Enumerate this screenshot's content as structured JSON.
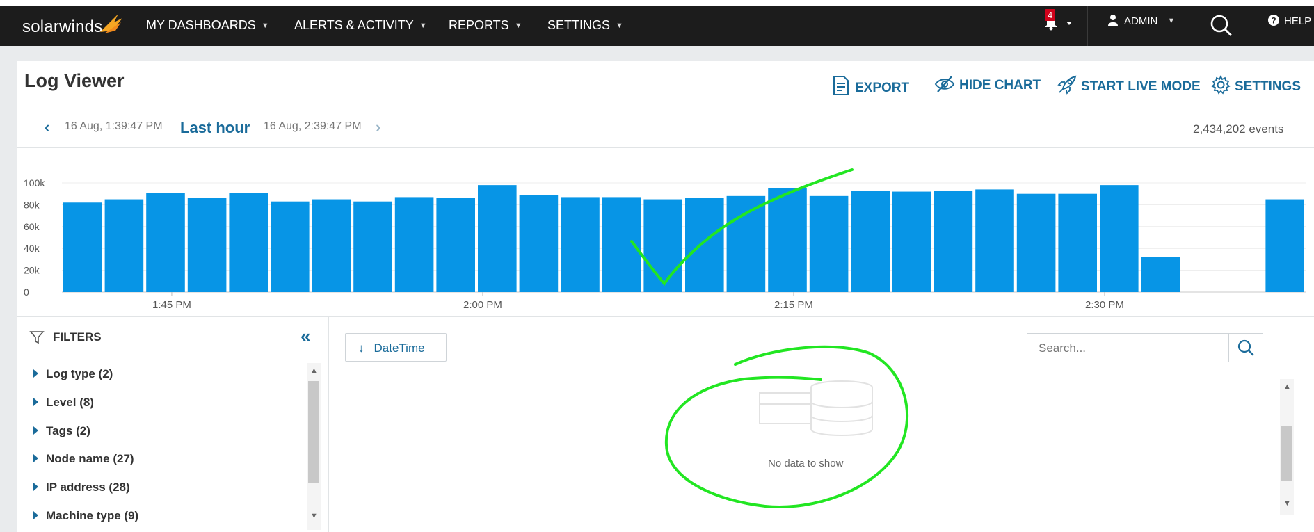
{
  "topbar": {
    "logo_text": "solarwinds",
    "nav": [
      {
        "label": "MY DASHBOARDS"
      },
      {
        "label": "ALERTS & ACTIVITY"
      },
      {
        "label": "REPORTS"
      },
      {
        "label": "SETTINGS"
      }
    ],
    "alert_count": "4",
    "user_label": "ADMIN",
    "help_label": "HELP"
  },
  "header": {
    "title": "Log Viewer",
    "actions": {
      "export": "EXPORT",
      "hide_chart": "HIDE CHART",
      "live_mode": "START LIVE MODE",
      "settings": "SETTINGS"
    }
  },
  "timerange": {
    "start": "16 Aug, 1:39:47 PM",
    "label": "Last hour",
    "end": "16 Aug, 2:39:47 PM",
    "events": "2,434,202 events"
  },
  "chart_data": {
    "type": "bar",
    "y_ticks": [
      "100k",
      "80k",
      "60k",
      "40k",
      "20k",
      "0"
    ],
    "ylim": [
      0,
      100000
    ],
    "x_ticks": [
      "1:45 PM",
      "2:00 PM",
      "2:15 PM",
      "2:30 PM"
    ],
    "values": [
      82000,
      85000,
      91000,
      86000,
      91000,
      83000,
      85000,
      83000,
      87000,
      86000,
      98000,
      89000,
      87000,
      87000,
      85000,
      86000,
      88000,
      95000,
      88000,
      93000,
      92000,
      93000,
      94000,
      90000,
      90000,
      98000,
      32000,
      0,
      0,
      85000
    ],
    "color": "#0795e6"
  },
  "filters": {
    "title": "FILTERS",
    "collapse_icon": "«",
    "items": [
      {
        "label": "Log type (2)"
      },
      {
        "label": "Level (8)"
      },
      {
        "label": "Tags (2)"
      },
      {
        "label": "Node name (27)"
      },
      {
        "label": "IP address (28)"
      },
      {
        "label": "Machine type (9)"
      }
    ]
  },
  "results": {
    "sort_label": "DateTime",
    "search_placeholder": "Search...",
    "empty_text": "No data to show"
  },
  "colors": {
    "accent": "#1a6b9a",
    "bar": "#0795e6",
    "topbar": "#1c1c1c",
    "annotation": "#22e622"
  }
}
